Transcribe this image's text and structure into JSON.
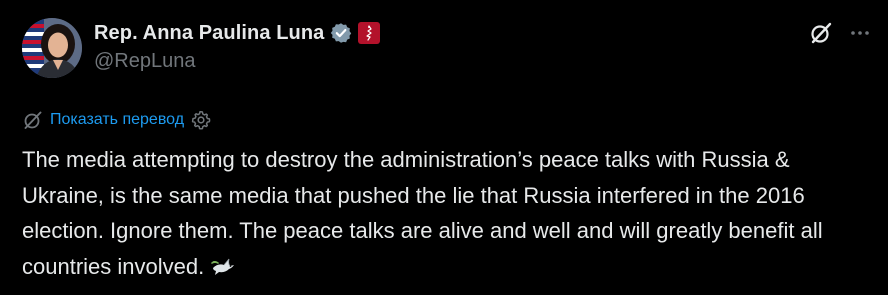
{
  "author": {
    "display_name": "Rep. Anna Paulina Luna",
    "handle": "@RepLuna",
    "avatar_icon": "profile-photo-with-us-flag",
    "verified_icon": "gray-verified-checkmark-icon",
    "affiliation_icon": "government-affiliation-badge-icon"
  },
  "top_actions": {
    "grok_icon": "grok-icon",
    "more_icon": "more-options-icon"
  },
  "translate": {
    "label": "Показать перевод",
    "icon": "translate-icon",
    "settings_icon": "gear-icon"
  },
  "tweet": {
    "text": "The media attempting to destroy the administration’s peace talks with Russia & Ukraine, is the same media that pushed the lie that Russia interfered in the 2016 election. Ignore them. The peace talks are alive and well and will greatly benefit all countries involved.",
    "emoji": "dove-of-peace-emoji"
  },
  "colors": {
    "background": "#000000",
    "text": "#e7e9ea",
    "secondary_text": "#71767b",
    "link": "#1d9bf0",
    "verified_gray": "#829aab",
    "affiliation_red": "#b3122b"
  }
}
